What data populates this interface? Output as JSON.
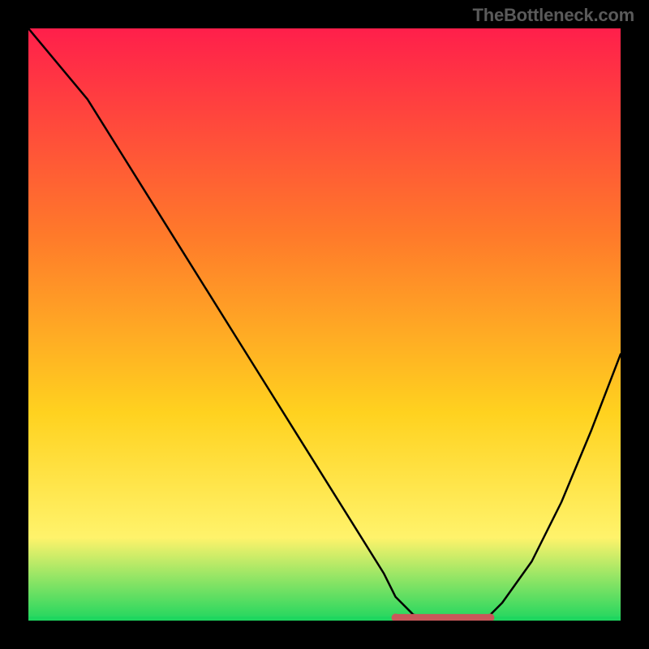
{
  "watermark": "TheBottleneck.com",
  "colors": {
    "bg_black": "#000000",
    "gradient_top": "#ff1f4b",
    "gradient_mid1": "#ff7a2a",
    "gradient_mid2": "#ffd21f",
    "gradient_mid3": "#fff36b",
    "gradient_bottom": "#1fd65f",
    "curve": "#000000",
    "marker_stroke": "#c9585a",
    "marker_fill": "#c9585a"
  },
  "chart_data": {
    "type": "line",
    "title": "",
    "xlabel": "",
    "ylabel": "",
    "xlim": [
      0,
      100
    ],
    "ylim": [
      0,
      100
    ],
    "grid": false,
    "legend": false,
    "annotations": [
      "TheBottleneck.com"
    ],
    "series": [
      {
        "name": "bottleneck-curve",
        "x": [
          0,
          5,
          10,
          15,
          20,
          25,
          30,
          35,
          40,
          45,
          50,
          55,
          60,
          62,
          65,
          70,
          75,
          78,
          80,
          85,
          90,
          95,
          100
        ],
        "y": [
          100,
          94,
          88,
          80,
          72,
          64,
          56,
          48,
          40,
          32,
          24,
          16,
          8,
          4,
          1,
          0,
          0,
          1,
          3,
          10,
          20,
          32,
          45
        ]
      }
    ],
    "optimal_band": {
      "name": "sweet-spot-marker",
      "x_start": 62,
      "x_end": 78,
      "y": 0.5
    }
  }
}
